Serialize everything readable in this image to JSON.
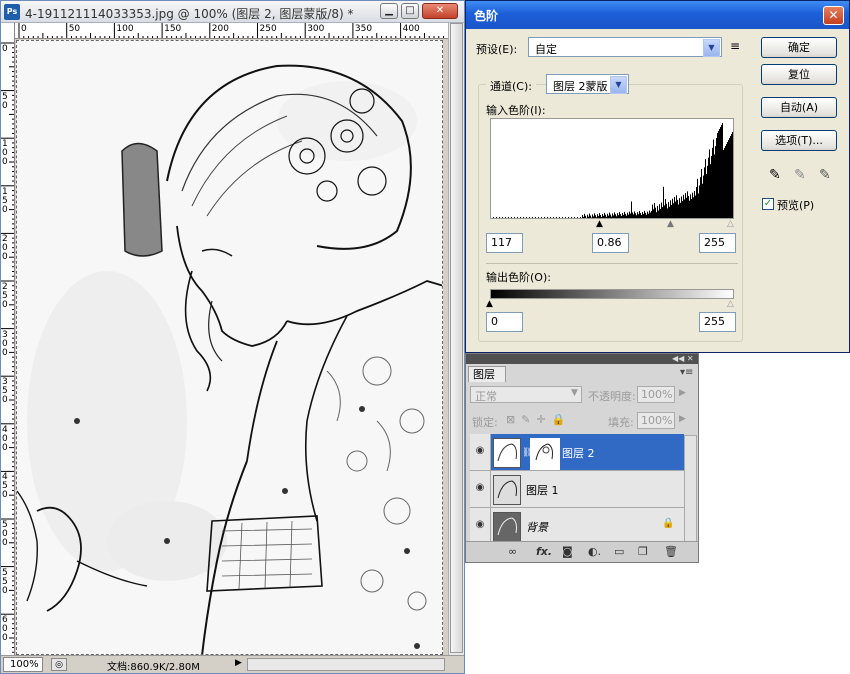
{
  "document": {
    "title": "4-191121114033353.jpg @ 100% (图层 2, 图层蒙版/8) *",
    "ruler_h": [
      "0",
      "50",
      "100",
      "150",
      "200",
      "250",
      "300",
      "350",
      "400"
    ],
    "ruler_v": [
      "0",
      "5\n0",
      "1\n0\n0",
      "1\n5\n0",
      "2\n0\n0",
      "2\n5\n0",
      "3\n0\n0",
      "3\n5\n0",
      "4\n0\n0",
      "4\n5\n0",
      "5\n0\n0",
      "5\n5\n0",
      "6\n0\n0"
    ],
    "status": {
      "zoom": "100%",
      "doc_info": "文档:860.9K/2.80M"
    }
  },
  "levels": {
    "title": "色阶",
    "close": "✕",
    "preset_label": "预设(E):",
    "preset_value": "自定",
    "channel_label": "通道(C):",
    "channel_value": "图层 2蒙版",
    "input_label": "输入色阶(I):",
    "input_values": {
      "black": "117",
      "gamma": "0.86",
      "white": "255"
    },
    "output_label": "输出色阶(O):",
    "output_values": {
      "black": "0",
      "white": "255"
    },
    "buttons": {
      "ok": "确定",
      "reset": "复位",
      "auto": "自动(A)",
      "options": "选项(T)..."
    },
    "preview_label": "预览(P)",
    "preview_checked": true,
    "histogram_color": "#000000"
  },
  "layers_panel": {
    "tab": "图层",
    "blend_mode": "正常",
    "opacity_label": "不透明度:",
    "opacity_value": "100%",
    "lock_label": "锁定:",
    "fill_label": "填充:",
    "fill_value": "100%",
    "layers": [
      {
        "name": "图层 2",
        "selected": true,
        "has_mask": true
      },
      {
        "name": "图层 1",
        "selected": false,
        "has_mask": false
      },
      {
        "name": "背景",
        "selected": false,
        "locked": true
      }
    ],
    "selected_color": "#316ac5"
  }
}
